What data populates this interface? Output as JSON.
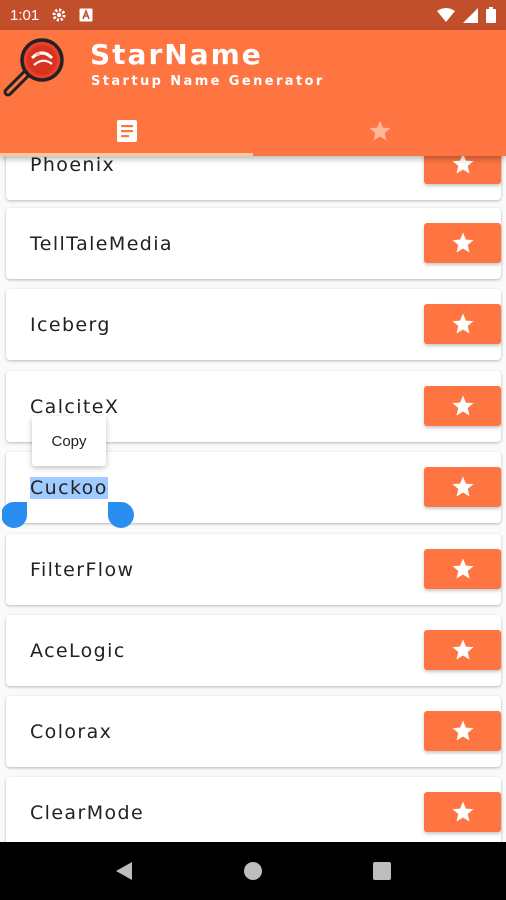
{
  "status_bar": {
    "time": "1:01",
    "icons": [
      "gear-icon",
      "a-notification-icon",
      "wifi-icon",
      "cell-signal-icon",
      "battery-icon"
    ]
  },
  "app_bar": {
    "title": "StarName",
    "subtitle": "Startup Name Generator",
    "logo": "magnifier-logo-icon",
    "tabs": [
      {
        "icon": "list-document-icon",
        "selected": true
      },
      {
        "icon": "star-icon",
        "selected": false
      }
    ]
  },
  "names": [
    {
      "label": "Phoenix"
    },
    {
      "label": "TellTaleMedia"
    },
    {
      "label": "Iceberg"
    },
    {
      "label": "CalciteX"
    },
    {
      "label": "Cuckoo"
    },
    {
      "label": "FilterFlow"
    },
    {
      "label": "AceLogic"
    },
    {
      "label": "Colorax"
    },
    {
      "label": "ClearMode"
    }
  ],
  "selection": {
    "selected_text": "Cuckoo",
    "menu_item": "Copy"
  },
  "nav_bar": {
    "icons": [
      "back-icon",
      "home-icon",
      "recents-icon"
    ]
  },
  "colors": {
    "primary": "#fe7542",
    "status_bar": "#c24f2c",
    "selection": "#9fcbff",
    "handle": "#2a8ef0"
  }
}
